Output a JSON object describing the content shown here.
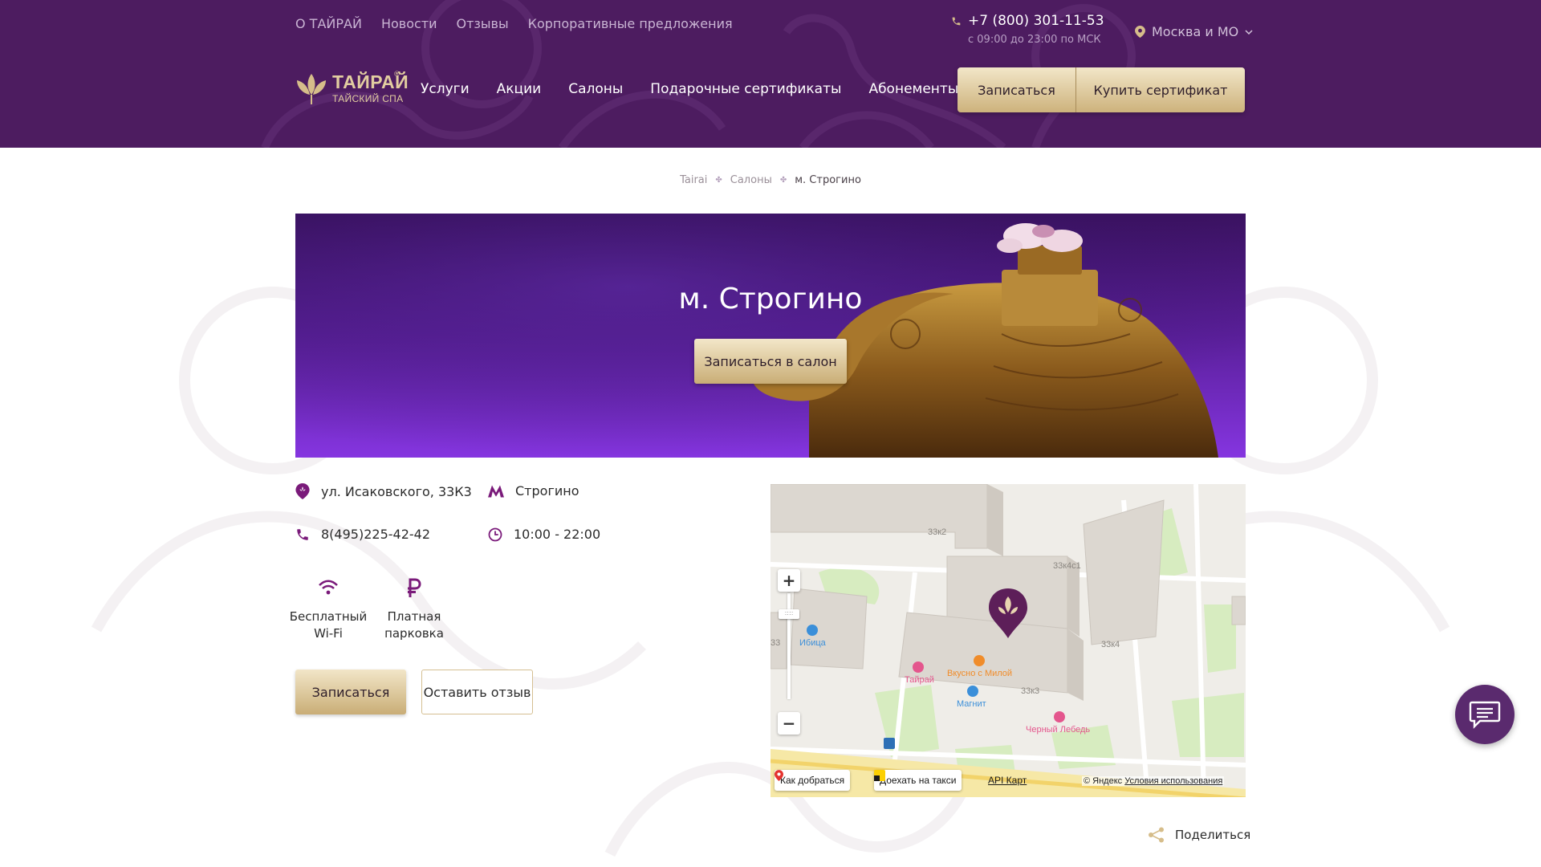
{
  "header": {
    "top_links": [
      "О ТАЙРАЙ",
      "Новости",
      "Отзывы",
      "Корпоративные предложения"
    ],
    "phone": "+7 (800) 301-11-53",
    "hours": "с 09:00 до 23:00 по МСК",
    "region": "Москва и МО",
    "logo_main": "ТАЙРАЙ",
    "logo_sub": "ТАЙСКИЙ СПА",
    "logo_reg": "®",
    "nav": [
      "Услуги",
      "Акции",
      "Салоны",
      "Подарочные сертификаты",
      "Абонементы"
    ],
    "book_label": "Записаться",
    "cert_label": "Купить сертификат"
  },
  "breadcrumb": {
    "items": [
      "Tairai",
      "Салоны",
      "м. Строгино"
    ],
    "separator": "✤"
  },
  "hero": {
    "title": "м. Строгино",
    "button_label": "Записаться в салон"
  },
  "info": {
    "address": "ул. Исаковского, 33К3",
    "metro": "Строгино",
    "phone": "8(495)225-42-42",
    "hours": "10:00 - 22:00",
    "amenities": [
      {
        "icon": "wifi-icon",
        "label_line1": "Бесплатный",
        "label_line2": "Wi-Fi"
      },
      {
        "icon": "ruble-icon",
        "label_line1": "Платная",
        "label_line2": "парковка"
      }
    ],
    "book_label": "Записаться",
    "review_label": "Оставить отзыв"
  },
  "map": {
    "zoom_in": "+",
    "zoom_out": "−",
    "zoom_handle": "::::",
    "route_label": "Как добраться",
    "taxi_label": "Доехать на такси",
    "api_label": "API Карт",
    "copyright_prefix": "© Яндекс",
    "terms_label": "Условия использования",
    "building_labels": [
      "33к2",
      "33к4с1",
      "33к4",
      "33к3",
      "33"
    ],
    "poi": [
      {
        "name": "Ибица",
        "color": "#3b8fd9"
      },
      {
        "name": "Тайрай",
        "color": "#e4568d"
      },
      {
        "name": "Вкусно с Милой",
        "color": "#f08c2a"
      },
      {
        "name": "Магнит",
        "color": "#3b8fd9"
      },
      {
        "name": "Черный Лебедь",
        "color": "#e4568d"
      }
    ]
  },
  "share_label": "Поделиться",
  "colors": {
    "header_bg": "#4d1c60",
    "accent_purple": "#7a1a7a",
    "gold": "#d6bd8a"
  }
}
